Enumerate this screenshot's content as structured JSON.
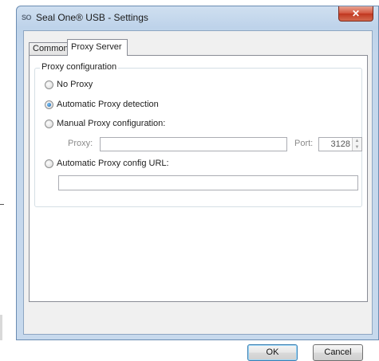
{
  "window": {
    "app_icon_text": "SO",
    "title": "Seal One® USB - Settings",
    "close_glyph": "✕"
  },
  "tabs": [
    {
      "label": "Common",
      "active": false
    },
    {
      "label": "Proxy Server",
      "active": true
    }
  ],
  "proxy_group": {
    "legend": "Proxy configuration",
    "options": {
      "no_proxy": {
        "label": "No Proxy",
        "checked": false
      },
      "auto_detect": {
        "label": "Automatic Proxy detection",
        "checked": true
      },
      "manual": {
        "label": "Manual Proxy configuration:",
        "checked": false
      },
      "auto_url": {
        "label": "Automatic Proxy config URL:",
        "checked": false
      }
    },
    "proxy_label": "Proxy:",
    "proxy_value": "",
    "port_label": "Port:",
    "port_value": "3128",
    "config_url_value": ""
  },
  "buttons": {
    "ok": "OK",
    "cancel": "Cancel"
  }
}
